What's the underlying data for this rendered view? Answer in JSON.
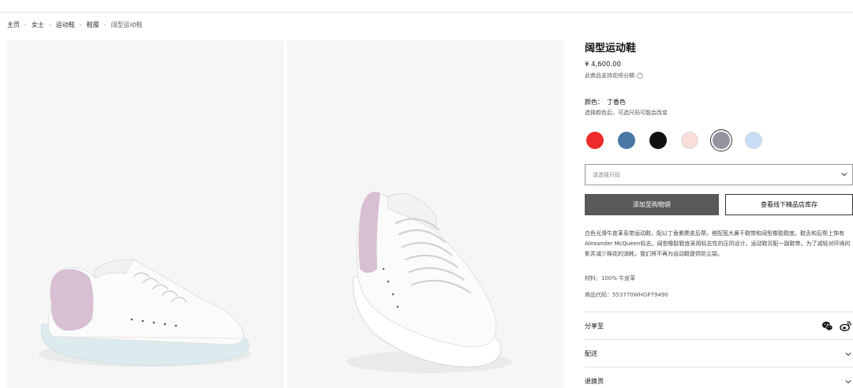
{
  "breadcrumb": [
    "主页",
    "女士",
    "运动鞋",
    "鞋履",
    "阔型运动鞋"
  ],
  "product": {
    "title": "阔型运动鞋",
    "price": "¥ 4,600.00",
    "installment": "此商品支持花呗分期",
    "color_label": "颜色：",
    "color_value": "丁香色",
    "color_hint": "选择颜色后，可选尺码可能会改变",
    "swatches": [
      {
        "name": "red",
        "hex": "#ee2a2a"
      },
      {
        "name": "blue",
        "hex": "#4a78a6"
      },
      {
        "name": "black",
        "hex": "#111111"
      },
      {
        "name": "pale-pink",
        "hex": "#f8ddd8"
      },
      {
        "name": "lilac-grey",
        "hex": "#9394a0",
        "selected": true
      },
      {
        "name": "light-blue",
        "hex": "#c7dcf5"
      }
    ],
    "size_placeholder": "请选择尺码",
    "add_to_bag": "添加至购物袋",
    "check_store": "查看线下精品店库存",
    "description": "白色光滑牛皮革系带运动鞋，配以丁香紫麂皮后帮。搭配宽大鼻干鞋带和阔型橡胶鞋底。鞋舌和后帮上饰有Alexander McQueen标志。阔型橡胶鞋底采用标志性的压凹设计。运动鞋另配一副鞋带。为了减轻对环境的影并减少棉花的消耗，我们将不再为运动鞋提供防尘袋。",
    "material": "材料：100% 牛皮革",
    "code": "商品代码：553770WHGP79490",
    "share_label": "分享至",
    "shipping_label": "配送",
    "returns_label": "退换货"
  },
  "colors": {
    "button_dark": "#595959",
    "image_bg": "#f6f6f6",
    "sole_tint": "#dcecee",
    "heel_lilac": "#d8bfd3"
  }
}
